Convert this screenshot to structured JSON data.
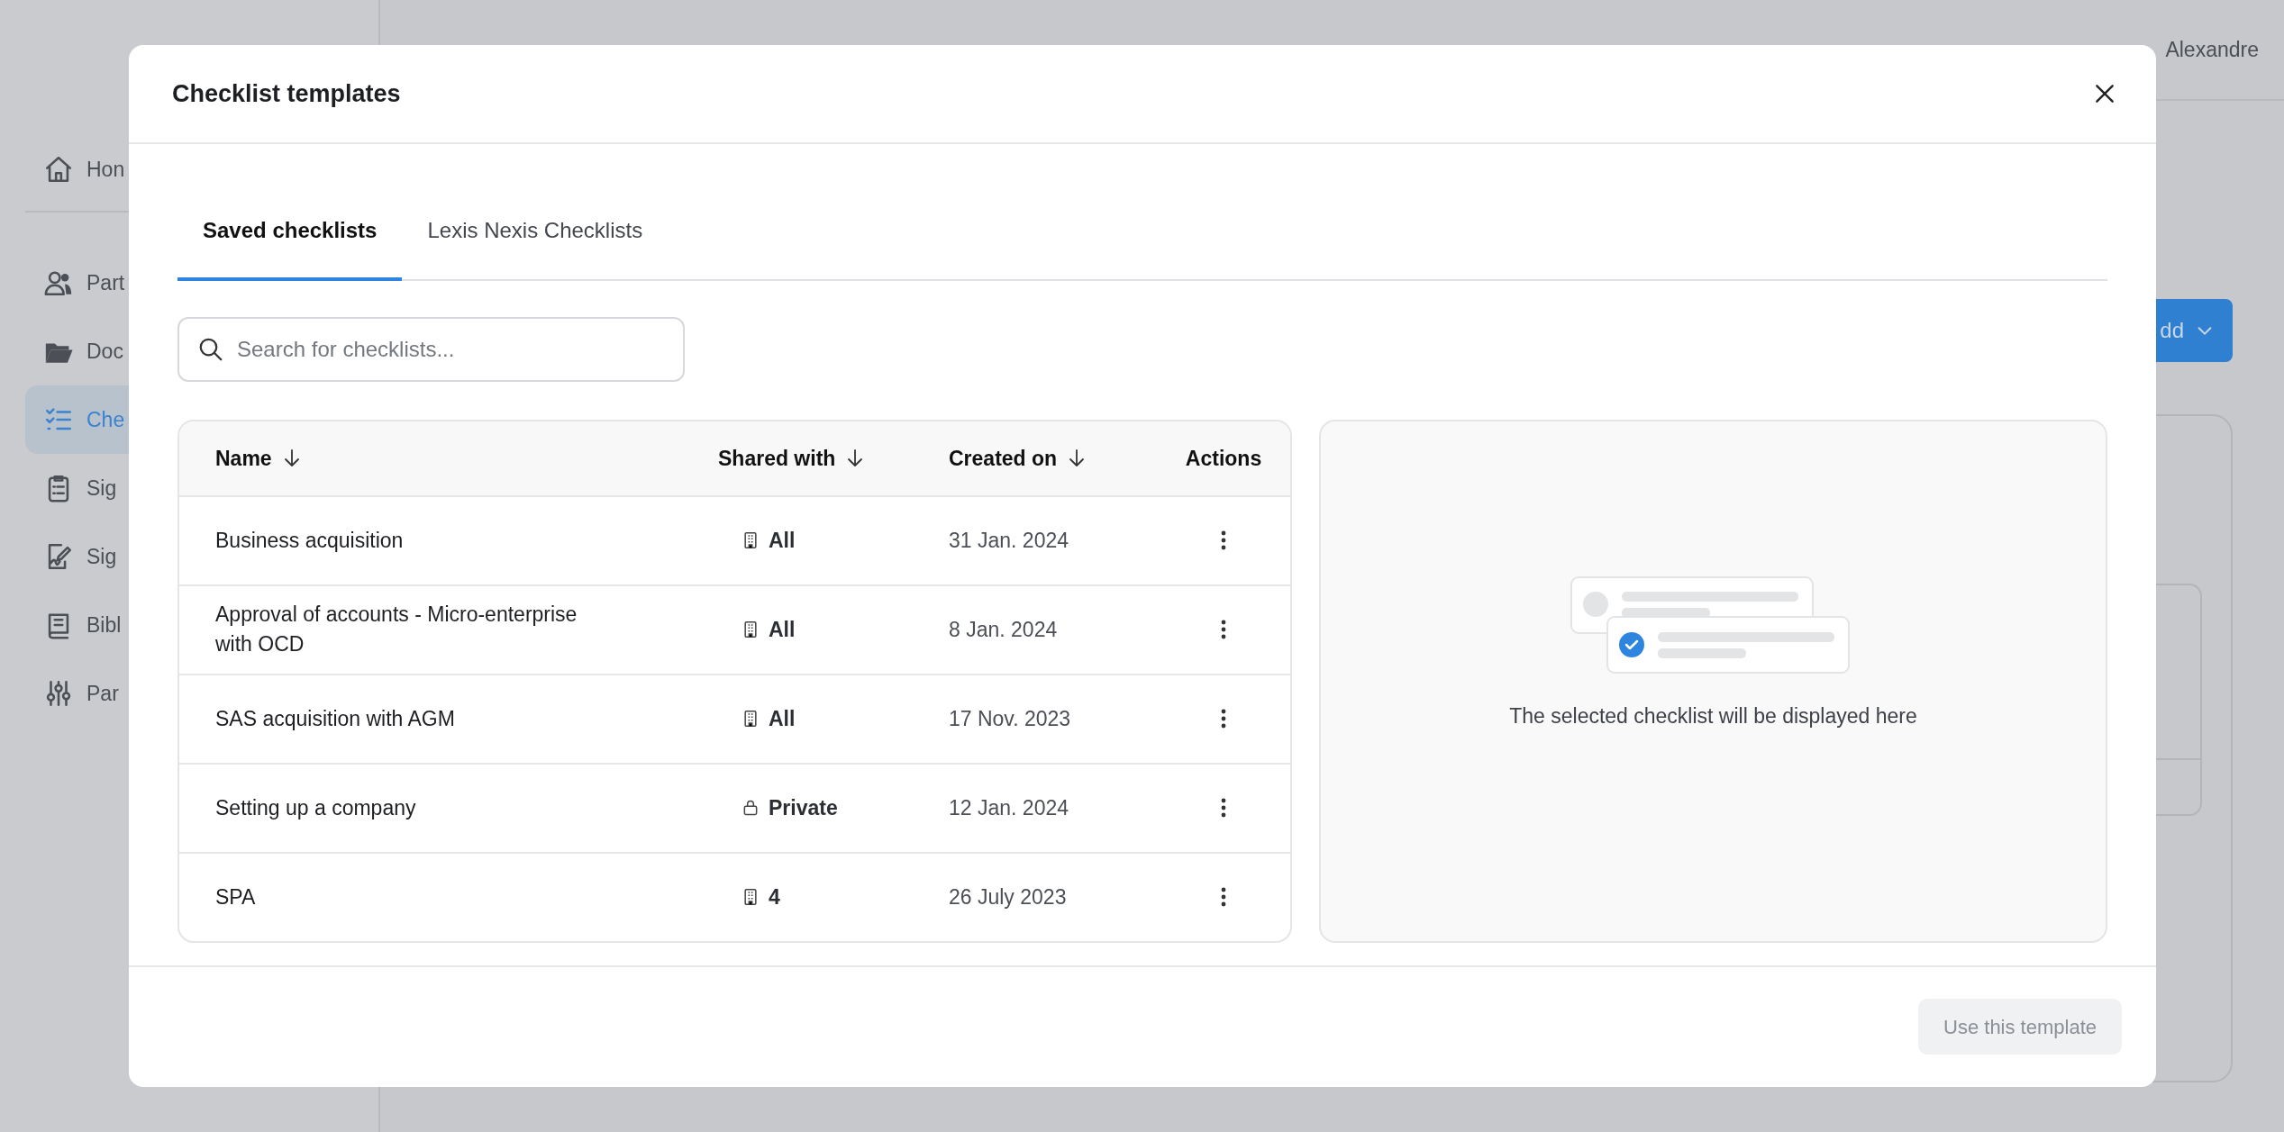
{
  "app": {
    "topbar": {
      "user": "Alexandre"
    },
    "sidebar": {
      "items": [
        {
          "label": "Hon",
          "selected": false
        },
        {
          "label": "Part",
          "selected": false
        },
        {
          "label": "Doc",
          "selected": false
        },
        {
          "label": "Che",
          "selected": true
        },
        {
          "label": "Sig",
          "selected": false
        },
        {
          "label": "Sig",
          "selected": false
        },
        {
          "label": "Bibl",
          "selected": false
        },
        {
          "label": "Par",
          "selected": false
        }
      ]
    },
    "add_button": "dd"
  },
  "modal": {
    "title": "Checklist templates",
    "tabs": [
      {
        "label": "Saved checklists",
        "selected": true
      },
      {
        "label": "Lexis Nexis Checklists",
        "selected": false
      }
    ],
    "search": {
      "placeholder": "Search for checklists..."
    },
    "table": {
      "columns": [
        {
          "label": "Name",
          "sortable": true
        },
        {
          "label": "Shared with",
          "sortable": true
        },
        {
          "label": "Created on",
          "sortable": true
        },
        {
          "label": "Actions",
          "sortable": false
        }
      ],
      "rows": [
        {
          "name": "Business acquisition",
          "kind": "company",
          "shared": "All",
          "created": "31 Jan. 2024"
        },
        {
          "name": "Approval of accounts - Micro-enterprise with OCD",
          "kind": "company",
          "shared": "All",
          "created": "8 Jan. 2024"
        },
        {
          "name": "SAS acquisition with AGM",
          "kind": "company",
          "shared": "All",
          "created": "17 Nov. 2023"
        },
        {
          "name": "Setting up a company",
          "kind": "private",
          "shared": "Private",
          "created": "12 Jan. 2024"
        },
        {
          "name": "SPA",
          "kind": "company",
          "shared": "4",
          "created": "26 July 2023"
        }
      ]
    },
    "preview": {
      "message": "The selected checklist will be displayed here"
    },
    "footer": {
      "button": "Use this template",
      "disabled": true
    }
  }
}
